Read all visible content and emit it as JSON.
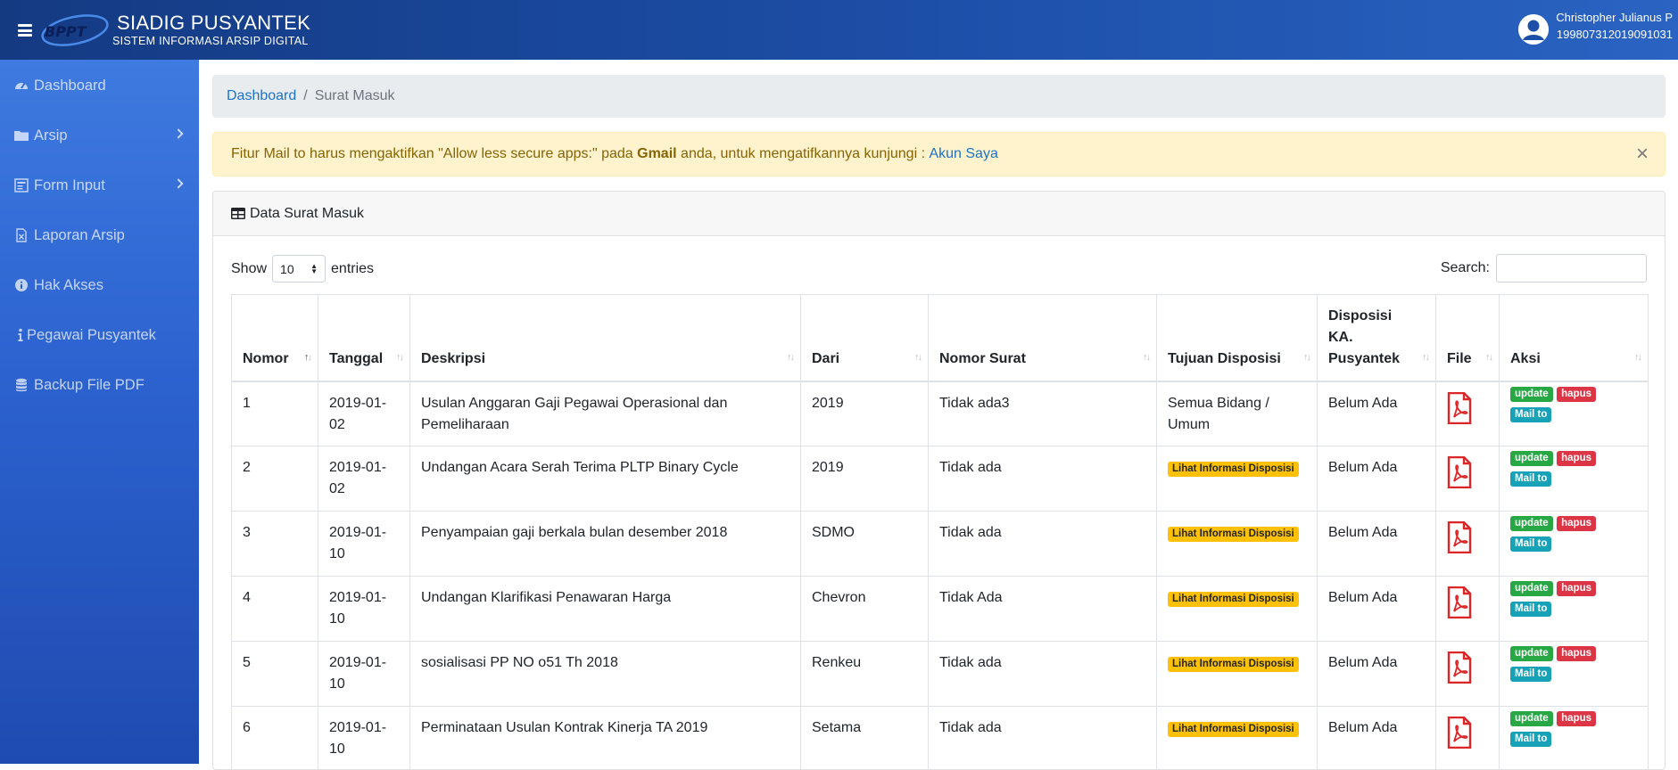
{
  "app": {
    "title": "SIADIG PUSYANTEK",
    "subtitle": "SISTEM INFORMASI ARSIP DIGITAL",
    "logo_text": "BPPT"
  },
  "user": {
    "name": "Christopher Julianus P",
    "nip": "199807312019091031"
  },
  "sidebar": {
    "items": [
      {
        "label": "Dashboard",
        "icon": "tachometer-icon"
      },
      {
        "label": "Arsip",
        "icon": "folder-icon",
        "has_children": true
      },
      {
        "label": "Form Input",
        "icon": "form-icon",
        "has_children": true
      },
      {
        "label": "Laporan Arsip",
        "icon": "excel-file-icon"
      },
      {
        "label": "Hak Akses",
        "icon": "info-circle-icon"
      },
      {
        "label": "Pegawai Pusyantek",
        "icon": "info-icon"
      },
      {
        "label": "Backup File PDF",
        "icon": "database-icon"
      }
    ]
  },
  "breadcrumb": {
    "home": "Dashboard",
    "separator": "/",
    "current": "Surat Masuk"
  },
  "alert": {
    "text_before": "Fitur Mail to harus mengaktifkan \"Allow less secure apps:\" pada ",
    "bold": "Gmail",
    "text_after": " anda, untuk mengatifkannya kunjungi : ",
    "link": "Akun Saya",
    "close": "×"
  },
  "card": {
    "title": "Data Surat Masuk"
  },
  "controls": {
    "show_label": "Show",
    "entries_value": "10",
    "entries_label": "entries",
    "search_label": "Search:",
    "search_value": ""
  },
  "table": {
    "columns": [
      "Nomor",
      "Tanggal",
      "Deskripsi",
      "Dari",
      "Nomor Surat",
      "Tujuan Disposisi",
      "Disposisi KA. Pusyantek",
      "File",
      "Aksi"
    ],
    "rows": [
      {
        "nomor": "1",
        "tanggal": "2019-01-02",
        "deskripsi": "Usulan Anggaran Gaji Pegawai Operasional dan Pemeliharaan",
        "dari": "2019",
        "nomor_surat": "Tidak ada3",
        "tujuan": "Semua Bidang / Umum",
        "tujuan_badge": false,
        "disposisi": "Belum Ada"
      },
      {
        "nomor": "2",
        "tanggal": "2019-01-02",
        "deskripsi": "Undangan Acara Serah Terima PLTP Binary Cycle",
        "dari": "2019",
        "nomor_surat": "Tidak ada",
        "tujuan": "Lihat Informasi Disposisi",
        "tujuan_badge": true,
        "disposisi": "Belum Ada"
      },
      {
        "nomor": "3",
        "tanggal": "2019-01-10",
        "deskripsi": "Penyampaian gaji berkala bulan desember 2018",
        "dari": "SDMO",
        "nomor_surat": "Tidak ada",
        "tujuan": "Lihat Informasi Disposisi",
        "tujuan_badge": true,
        "disposisi": "Belum Ada"
      },
      {
        "nomor": "4",
        "tanggal": "2019-01-10",
        "deskripsi": "Undangan Klarifikasi Penawaran Harga",
        "dari": "Chevron",
        "nomor_surat": "Tidak Ada",
        "tujuan": "Lihat Informasi Disposisi",
        "tujuan_badge": true,
        "disposisi": "Belum Ada"
      },
      {
        "nomor": "5",
        "tanggal": "2019-01-10",
        "deskripsi": "sosialisasi PP NO o51 Th 2018",
        "dari": "Renkeu",
        "nomor_surat": "Tidak ada",
        "tujuan": "Lihat Informasi Disposisi",
        "tujuan_badge": true,
        "disposisi": "Belum Ada"
      },
      {
        "nomor": "6",
        "tanggal": "2019-01-10",
        "deskripsi": "Perminataan Usulan Kontrak Kinerja TA 2019",
        "dari": "Setama",
        "nomor_surat": "Tidak ada",
        "tujuan": "Lihat Informasi Disposisi",
        "tujuan_badge": true,
        "disposisi": "Belum Ada"
      }
    ],
    "actions": {
      "update": "update",
      "hapus": "hapus",
      "mail": "Mail to"
    },
    "file_icon": "pdf-file-icon"
  },
  "colors": {
    "topbar": "#1c4fa8",
    "sidebar": "#2c62cf",
    "link": "#1a73c7",
    "alert_bg": "#fff3cd",
    "pdf_red": "#dc2626"
  }
}
